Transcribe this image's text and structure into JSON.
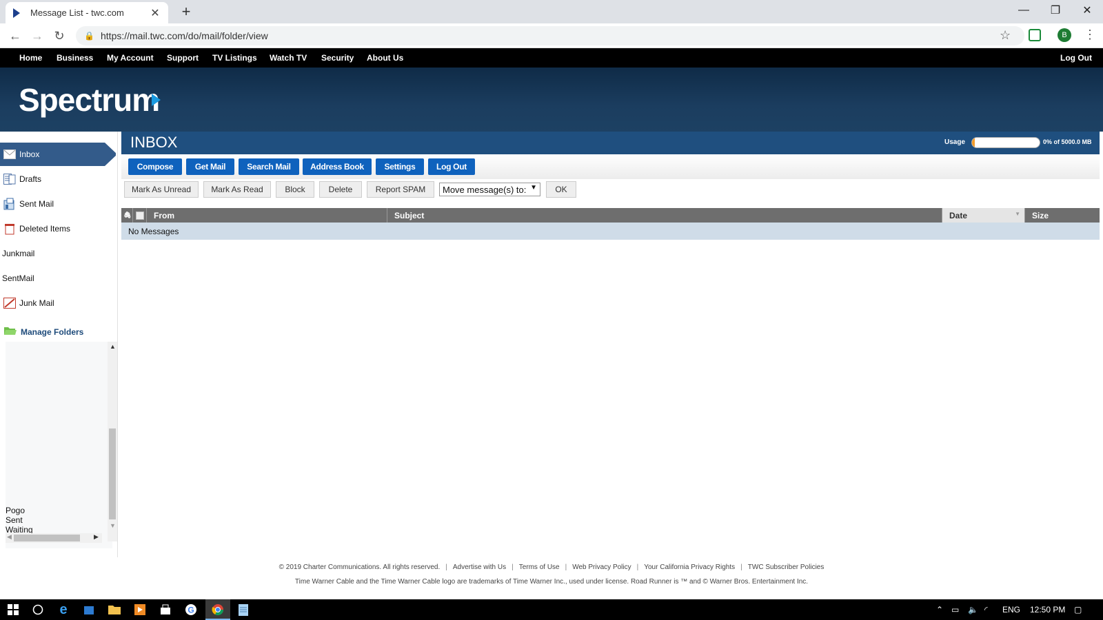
{
  "browser": {
    "tab_title": "Message List - twc.com",
    "tab_close": "✕",
    "new_tab": "+",
    "url": "https://mail.twc.com/do/mail/folder/view",
    "profile_initial": "B"
  },
  "topnav": {
    "items": [
      "Home",
      "Business",
      "My Account",
      "Support",
      "TV Listings",
      "Watch TV",
      "Security",
      "About Us"
    ],
    "logout": "Log Out"
  },
  "brand": {
    "logo_text": "Spectrum"
  },
  "sidebar": {
    "folders": [
      {
        "label": "Inbox",
        "icon": "envelope-icon"
      },
      {
        "label": "Drafts",
        "icon": "drafts-icon"
      },
      {
        "label": "Sent Mail",
        "icon": "sent-icon"
      },
      {
        "label": "Deleted Items",
        "icon": "trash-icon"
      },
      {
        "label": "Junkmail",
        "icon": ""
      },
      {
        "label": "SentMail",
        "icon": ""
      },
      {
        "label": "Junk Mail",
        "icon": "junk-icon"
      }
    ],
    "manage_folders": "Manage Folders",
    "tree_items": [
      "Pogo",
      "Sent",
      "Waiting"
    ]
  },
  "mailbox": {
    "title": "INBOX",
    "usage_label": "Usage",
    "usage_percent": 0,
    "usage_text": "0% of 5000.0 MB"
  },
  "toolbar": {
    "buttons": [
      "Compose",
      "Get Mail",
      "Search Mail",
      "Address Book",
      "Settings",
      "Log Out"
    ]
  },
  "actions": {
    "buttons": [
      "Mark As Unread",
      "Mark As Read",
      "Block",
      "Delete",
      "Report SPAM"
    ],
    "move_select": "Move message(s) to:",
    "ok": "OK"
  },
  "table": {
    "columns": [
      "From",
      "Subject",
      "Date",
      "Size"
    ],
    "empty_text": "No Messages"
  },
  "footer": {
    "links": [
      "© 2019 Charter Communications. All rights reserved.",
      "Advertise with Us",
      "Terms of Use",
      "Web Privacy Policy",
      "Your California Privacy Rights",
      "TWC Subscriber Policies"
    ],
    "separator": "|",
    "trademark": "Time Warner Cable and the Time Warner Cable logo are trademarks of Time Warner Inc., used under license. Road Runner is ™ and © Warner Bros. Entertainment Inc."
  },
  "taskbar": {
    "language": "ENG",
    "time": "12:50 PM"
  },
  "colors": {
    "brand_blue": "#0f62bd",
    "header_navy": "#1f4f7f",
    "usage_orange": "#f39c2a"
  }
}
